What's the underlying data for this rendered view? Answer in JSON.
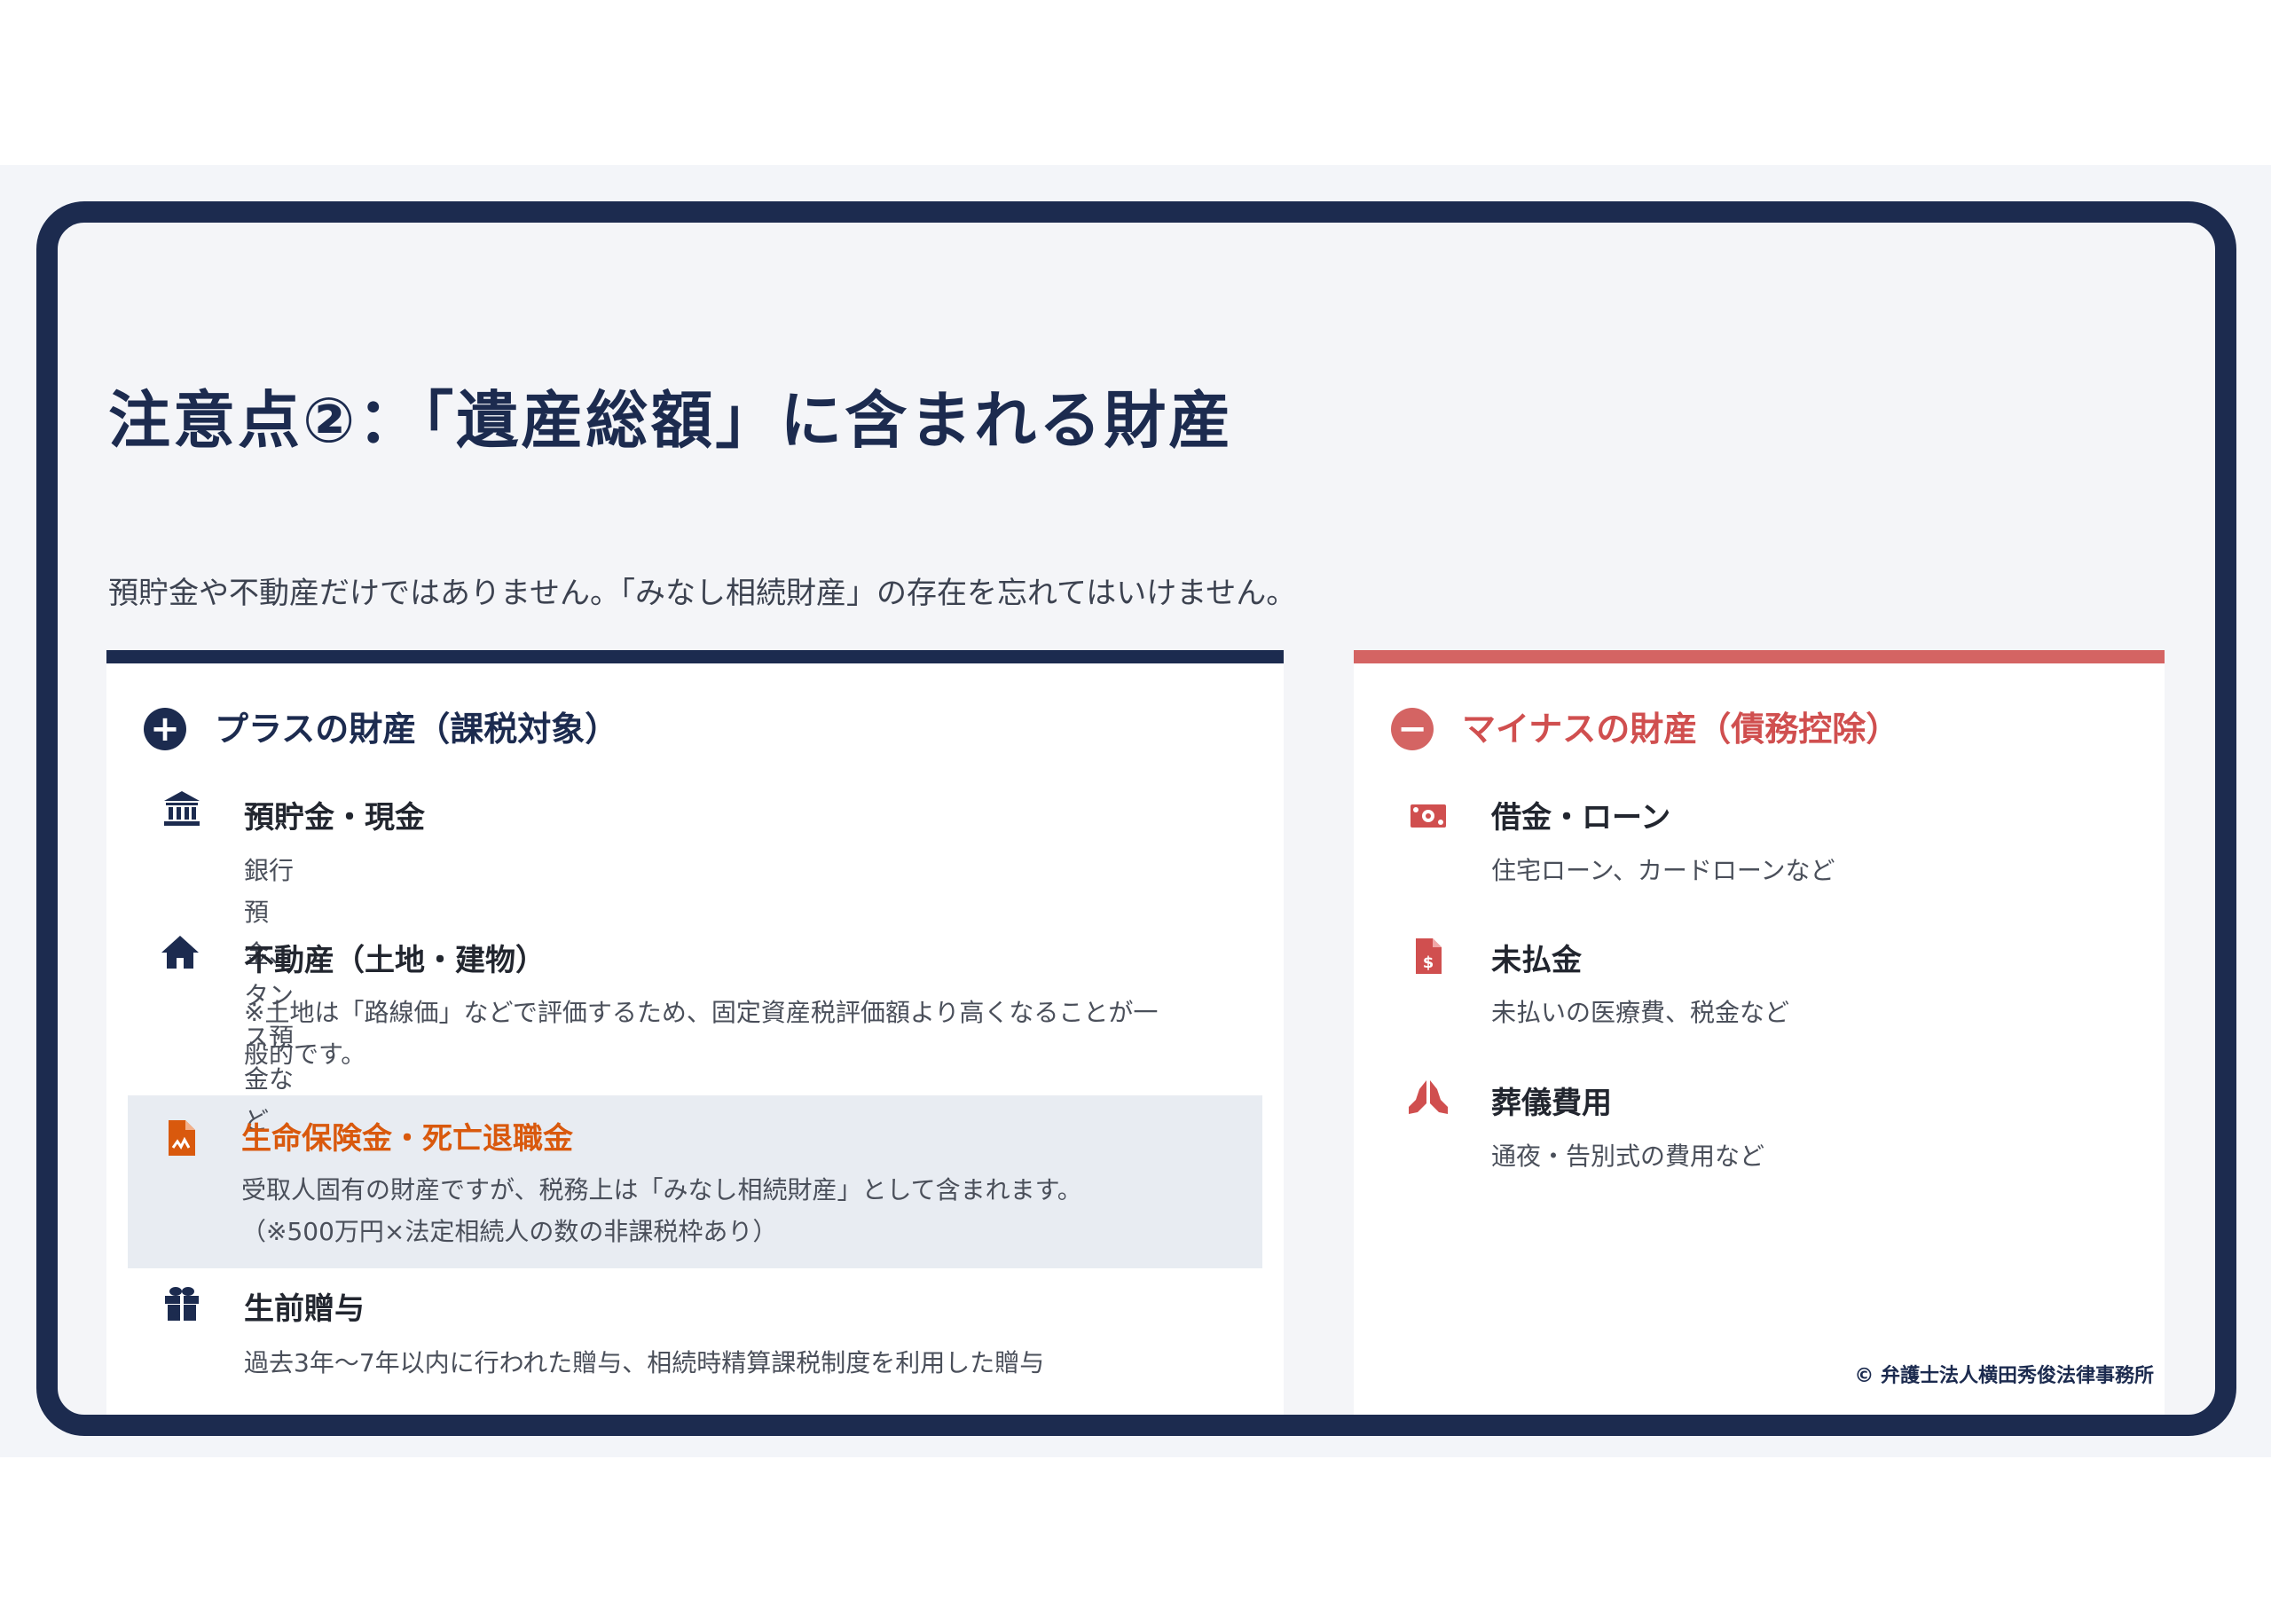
{
  "title": "注意点②：「遺産総額」に含まれる財産",
  "subtitle": "預貯金や不動産だけではありません。「みなし相続財産」の存在を忘れてはいけません。",
  "plus": {
    "heading": "プラスの財産（課税対象）",
    "icon": "plus-circle-icon",
    "items": [
      {
        "icon": "bank-icon",
        "title": "預貯金・現金",
        "desc": "銀行預金、タンス預金など"
      },
      {
        "icon": "house-icon",
        "title": "不動産（土地・建物）",
        "desc1": "※土地は「路線価」などで評価するため、固定資産税評価額より高くなることが一",
        "desc2": "般的です。"
      },
      {
        "icon": "document-icon",
        "title": "生命保険金・死亡退職金",
        "desc1": "受取人固有の財産ですが、税務上は「みなし相続財産」として含まれます。",
        "desc2": "（※500万円×法定相続人の数の非課税枠あり）",
        "highlighted": true
      },
      {
        "icon": "gift-icon",
        "title": "生前贈与",
        "desc": "過去3年〜7年以内に行われた贈与、相続時精算課税制度を利用した贈与"
      }
    ]
  },
  "minus": {
    "heading": "マイナスの財産（債務控除）",
    "icon": "minus-circle-icon",
    "items": [
      {
        "icon": "money-bill-icon",
        "title": "借金・ローン",
        "desc": "住宅ローン、カードローンなど"
      },
      {
        "icon": "invoice-dollar-icon",
        "title": "未払金",
        "desc": "未払いの医療費、税金など"
      },
      {
        "icon": "praying-hands-icon",
        "title": "葬儀費用",
        "desc": "通夜・告別式の費用など"
      }
    ]
  },
  "copyright": "© 弁護士法人横田秀俊法律事務所",
  "colors": {
    "navy": "#1c2b4f",
    "red": "#d46463",
    "orange": "#d9590d",
    "highlight_bg": "#e8ecf2"
  }
}
